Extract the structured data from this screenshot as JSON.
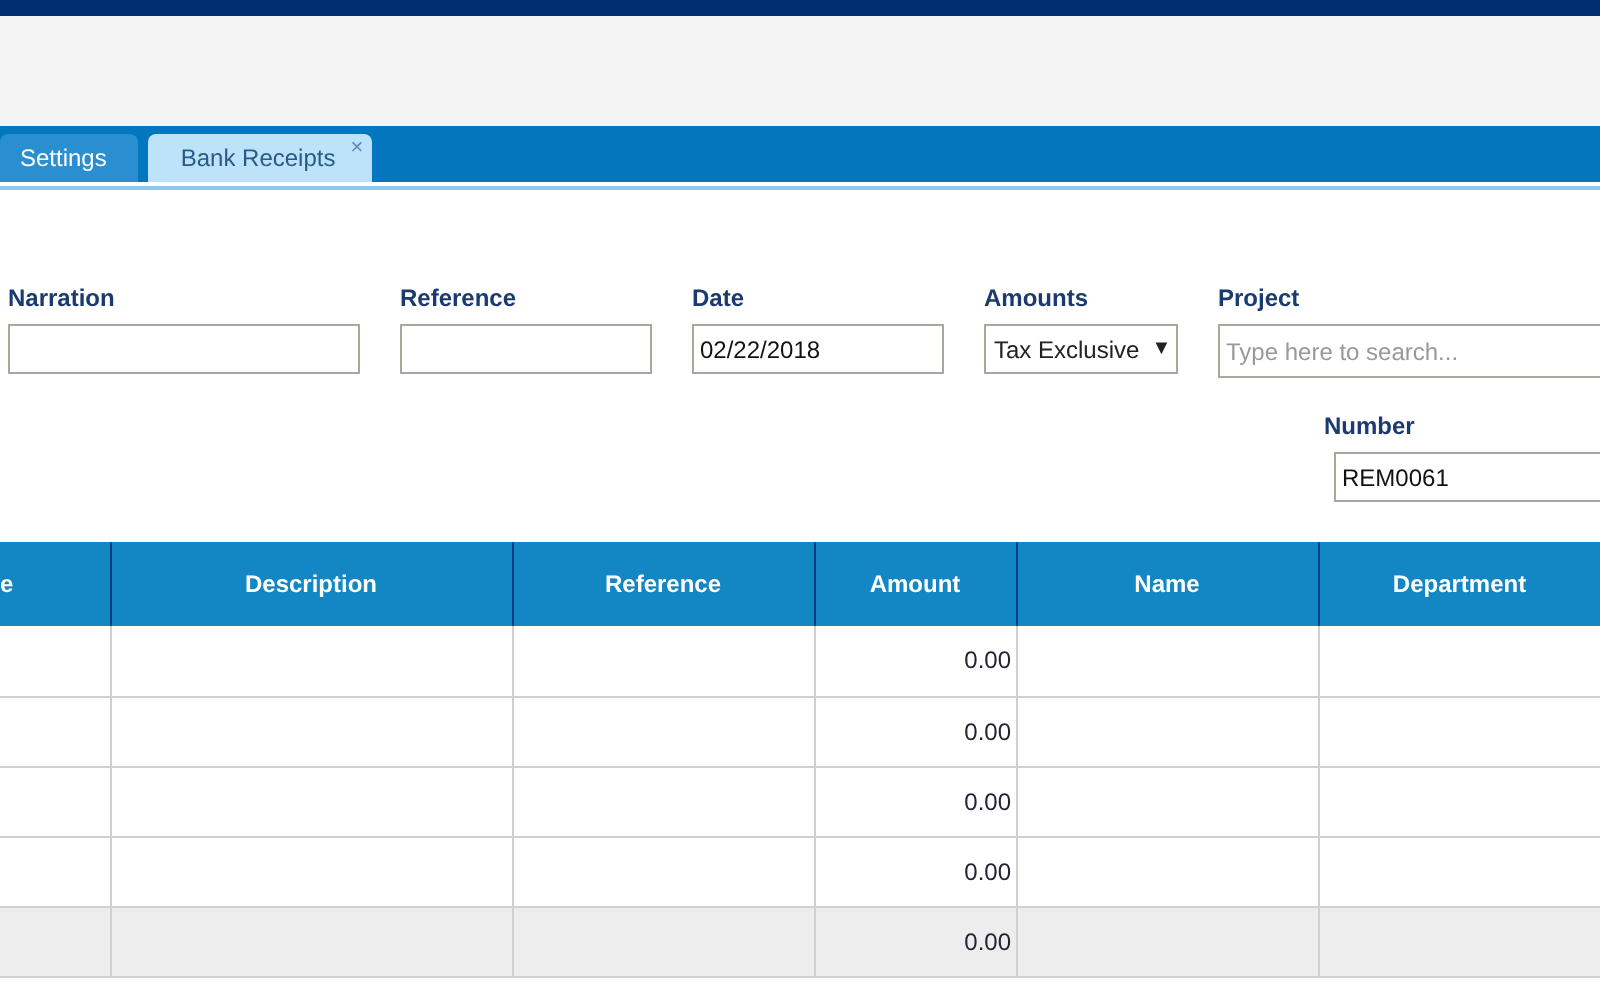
{
  "tabs": [
    {
      "label": "Settings",
      "selected": false
    },
    {
      "label": "Bank Receipts",
      "selected": true,
      "close_glyph": "×"
    }
  ],
  "fields": [
    {
      "label": "Narration",
      "kind": "text"
    },
    {
      "label": "Reference",
      "kind": "text"
    },
    {
      "label": "Date",
      "kind": "date",
      "value": "02/22/2018"
    },
    {
      "label": "Amounts",
      "kind": "select",
      "value": "Tax Exclusive",
      "caret": "▼"
    },
    {
      "label": "Project",
      "kind": "search",
      "placeholder": "Type here to search..."
    }
  ],
  "number": {
    "label": "Number",
    "value": "REM0061"
  },
  "table": {
    "columns": [
      "e",
      "Description",
      "Reference",
      "Amount",
      "Name",
      "Department"
    ],
    "rows": [
      {
        "kind": "entry",
        "amount": "0.00"
      },
      {
        "kind": "entry",
        "amount": "0.00"
      },
      {
        "kind": "entry",
        "amount": "0.00"
      },
      {
        "kind": "entry",
        "amount": "0.00"
      },
      {
        "kind": "shaded",
        "amount": "0.00"
      }
    ]
  }
}
